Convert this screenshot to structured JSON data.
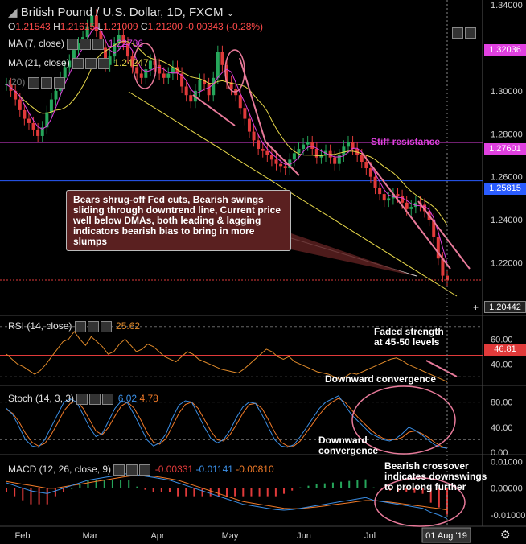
{
  "header": {
    "symbol": "British Pound / U.S. Dollar",
    "interval": "1D",
    "exchange": "FXCM",
    "open_label": "O",
    "open": "1.21543",
    "high_label": "H",
    "high": "1.21615",
    "low_label": "L",
    "low": "1.21009",
    "close_label": "C",
    "close": "1.21200",
    "change": "-0.00343 (-0.28%)"
  },
  "indicators": {
    "ma7": {
      "label": "MA (7, close)",
      "value": "1.22786"
    },
    "ma21": {
      "label": "MA (21, close)",
      "value": "1.24247"
    },
    "hidden": {
      "label": "(20)"
    },
    "rsi": {
      "label": "RSI (14, close)",
      "value": "25.62"
    },
    "stoch": {
      "label": "Stoch (14, 3, 3)",
      "k": "6.02",
      "d": "4.78"
    },
    "macd": {
      "label": "MACD (12, 26, close, 9)",
      "hist": "-0.00331",
      "macd": "-0.01141",
      "signal": "-0.00810"
    }
  },
  "annotations": {
    "box": "Bears shrug-off Fed cuts, Bearish swings sliding through downtrend line, Current price well below DMAs, both leading & lagging indicators bearish bias to bring in more slumps",
    "stiff": "Stiff resistance",
    "faded_1": "Faded strength",
    "faded_2": "at 45-50 levels",
    "rsi_conv": "Downward convergence",
    "stoch_conv_1": "Downward",
    "stoch_conv_2": "convergence",
    "macd_1": "Bearish crossover",
    "macd_2": "indicates downswings",
    "macd_3": "to prolong further"
  },
  "price_tags": {
    "t1": "1.32036",
    "t2": "1.27601",
    "t3": "1.25815",
    "t4": "1.20442",
    "rsi": "46.81"
  },
  "colors": {
    "accent": "#e040e0",
    "blue": "#2a5cff",
    "yellow": "#e8d84a",
    "up": "#26a65b",
    "down": "#e03a3a",
    "rsi": "#e08a2a",
    "stoch_k": "#3b8fe6",
    "stoch_d": "#f07a28"
  },
  "chart_data": [
    {
      "type": "line",
      "subtype": "candlestick",
      "ylim": [
        1.2,
        1.34
      ],
      "ticks": [
        "1.34000",
        "1.32000",
        "1.30000",
        "1.28000",
        "1.26000",
        "1.24000",
        "1.22000"
      ],
      "tick_values": [
        1.34,
        1.32,
        1.3,
        1.28,
        1.26,
        1.24,
        1.22
      ],
      "x_labels": [
        "Feb",
        "Mar",
        "Apr",
        "May",
        "Jun",
        "Jul"
      ],
      "x_date_label": "01 Aug '19",
      "grid": false,
      "levels": [
        1.32036,
        1.27601,
        1.25815
      ],
      "series": [
        {
          "name": "",
          "values": [
            1.303,
            1.3,
            1.296,
            1.291,
            1.287,
            1.285,
            1.282,
            1.279,
            1.283,
            1.29,
            1.296,
            1.3,
            1.306,
            1.311,
            1.314,
            1.319,
            1.322,
            1.325,
            1.33,
            1.335,
            1.328,
            1.32,
            1.312,
            1.316,
            1.322,
            1.326,
            1.322,
            1.316,
            1.311,
            1.308,
            1.306,
            1.31,
            1.314,
            1.312,
            1.308,
            1.306,
            1.308,
            1.311,
            1.308,
            1.302,
            1.298,
            1.295,
            1.3,
            1.305,
            1.303,
            1.298,
            1.306,
            1.318,
            1.312,
            1.304,
            1.301,
            1.298,
            1.292,
            1.287,
            1.281,
            1.277,
            1.273,
            1.272,
            1.27,
            1.268,
            1.266,
            1.265,
            1.264,
            1.268,
            1.271,
            1.273,
            1.275,
            1.276,
            1.273,
            1.269,
            1.27,
            1.272,
            1.269,
            1.266,
            1.27,
            1.274,
            1.276,
            1.273,
            1.27,
            1.267,
            1.264,
            1.26,
            1.255,
            1.252,
            1.249,
            1.25,
            1.252,
            1.251,
            1.248,
            1.245,
            1.246,
            1.248,
            1.247,
            1.244,
            1.24,
            1.232,
            1.222,
            1.214,
            1.212
          ]
        }
      ]
    },
    {
      "type": "line",
      "ylim": [
        25,
        75
      ],
      "ticks": [
        "60.00",
        "40.00"
      ],
      "tick_values": [
        60,
        40
      ],
      "series": [
        {
          "name": "",
          "values": [
            48,
            44,
            40,
            38,
            35,
            32,
            35,
            40,
            46,
            52,
            58,
            60,
            66,
            60,
            55,
            62,
            58,
            54,
            48,
            50,
            56,
            60,
            55,
            50,
            52,
            56,
            54,
            50,
            46,
            44,
            42,
            46,
            50,
            48,
            44,
            42,
            40,
            38,
            36,
            35,
            34,
            33,
            36,
            40,
            44,
            48,
            52,
            50,
            46,
            44,
            46,
            42,
            40,
            38,
            36,
            34,
            33,
            32,
            30,
            28,
            30,
            33,
            32,
            34,
            36,
            38,
            40,
            42,
            44,
            45,
            43,
            40,
            38,
            36,
            34,
            32,
            30,
            28,
            26
          ]
        }
      ]
    },
    {
      "type": "line",
      "ylim": [
        0,
        100
      ],
      "ticks": [
        "80.00",
        "40.00",
        "0.00"
      ],
      "tick_values": [
        80,
        40,
        0
      ],
      "series": [
        {
          "name": "",
          "values": [
            70,
            60,
            40,
            20,
            10,
            8,
            20,
            40,
            60,
            80,
            85,
            80,
            60,
            40,
            25,
            30,
            50,
            70,
            82,
            78,
            60,
            40,
            20,
            10,
            15,
            30,
            55,
            75,
            82,
            80,
            60,
            40,
            22,
            15,
            20,
            35,
            55,
            72,
            80,
            78,
            60,
            40,
            20,
            10,
            8,
            12,
            25,
            40,
            55,
            70,
            80,
            85,
            90,
            75,
            60,
            50,
            40,
            30,
            25,
            20,
            18,
            22,
            30,
            40,
            35,
            28,
            20,
            12,
            8,
            6
          ]
        },
        {
          "name": "",
          "values": [
            68,
            62,
            48,
            30,
            16,
            10,
            14,
            28,
            46,
            66,
            78,
            82,
            70,
            52,
            34,
            28,
            40,
            58,
            74,
            80,
            70,
            52,
            32,
            16,
            13,
            22,
            42,
            62,
            76,
            80,
            70,
            52,
            34,
            20,
            18,
            28,
            44,
            62,
            76,
            78,
            70,
            52,
            32,
            16,
            10,
            10,
            18,
            32,
            46,
            60,
            72,
            80,
            86,
            80,
            68,
            56,
            46,
            36,
            28,
            22,
            20,
            20,
            24,
            32,
            34,
            30,
            24,
            16,
            10,
            6
          ]
        }
      ]
    },
    {
      "type": "line",
      "ylim": [
        -0.013,
        0.011
      ],
      "ticks": [
        "0.01000",
        "0.00000",
        "-0.01000"
      ],
      "tick_values": [
        0.01,
        0,
        -0.01
      ],
      "series": [
        {
          "name": "",
          "values": [
            0.002,
            0.001,
            0.0,
            -0.001,
            -0.0015,
            -0.002,
            -0.001,
            0.0,
            0.001,
            0.002,
            0.003,
            0.0035,
            0.004,
            0.0045,
            0.005,
            0.0055,
            0.005,
            0.0045,
            0.004,
            0.0035,
            0.003,
            0.002,
            0.001,
            0.0,
            -0.001,
            -0.002,
            -0.003,
            -0.004,
            -0.005,
            -0.006,
            -0.0065,
            -0.007,
            -0.0075,
            -0.008,
            -0.0082,
            -0.008,
            -0.0075,
            -0.007,
            -0.0065,
            -0.006,
            -0.0055,
            -0.005,
            -0.0045,
            -0.004,
            -0.0035,
            -0.0045,
            -0.005,
            -0.0055,
            -0.006,
            -0.0065,
            -0.007,
            -0.0075,
            -0.009,
            -0.01,
            -0.0114
          ]
        },
        {
          "name": "",
          "values": [
            0.0025,
            0.002,
            0.0015,
            0.001,
            0.0005,
            0.0,
            0.0,
            0.0005,
            0.001,
            0.0015,
            0.002,
            0.0025,
            0.003,
            0.0035,
            0.004,
            0.0045,
            0.0048,
            0.0047,
            0.0045,
            0.004,
            0.0035,
            0.003,
            0.002,
            0.001,
            0.0,
            -0.001,
            -0.002,
            -0.003,
            -0.004,
            -0.005,
            -0.0055,
            -0.006,
            -0.0065,
            -0.007,
            -0.0075,
            -0.0077,
            -0.0076,
            -0.0073,
            -0.007,
            -0.0066,
            -0.0062,
            -0.0058,
            -0.0054,
            -0.005,
            -0.0046,
            -0.0046,
            -0.0048,
            -0.0052,
            -0.0056,
            -0.006,
            -0.0064,
            -0.0068,
            -0.0072,
            -0.0076,
            -0.0081
          ]
        }
      ]
    }
  ]
}
